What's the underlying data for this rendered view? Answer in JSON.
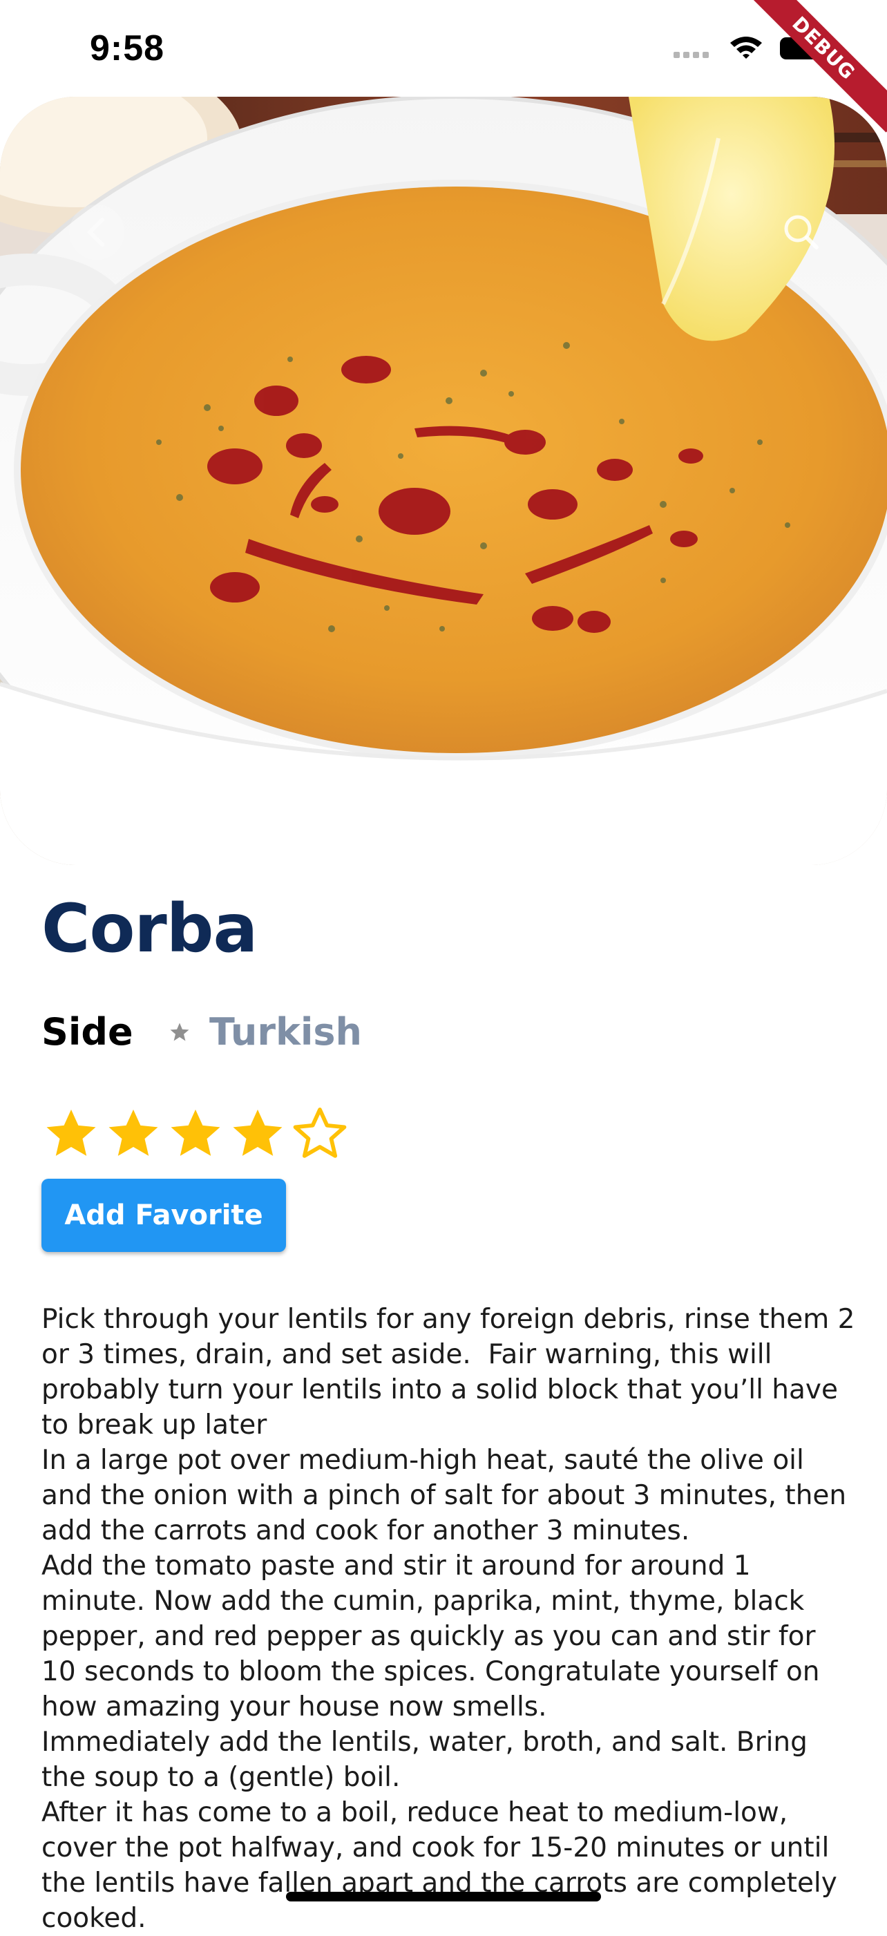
{
  "status_bar": {
    "time": "9:58",
    "icons": [
      "cellular-signal-icon",
      "wifi-icon",
      "battery-icon"
    ],
    "debug_banner": "DEBUG"
  },
  "hero": {
    "image_subject": "bowl of red lentil soup with lemon and bread",
    "icons": [
      "back-icon",
      "search-icon"
    ]
  },
  "meal": {
    "title": "Corba",
    "category": "Side",
    "area": "Turkish",
    "rating": 4,
    "rating_max": 5
  },
  "actions": {
    "favorite_label": "Add Favorite"
  },
  "instructions": "Pick through your lentils for any foreign debris, rinse them 2 or 3 times, drain, and set aside.  Fair warning, this will probably turn your lentils into a solid block that you’ll have to break up later\nIn a large pot over medium-high heat, sauté the olive oil and the onion with a pinch of salt for about 3 minutes, then add the carrots and cook for another 3 minutes.\nAdd the tomato paste and stir it around for around 1 minute. Now add the cumin, paprika, mint, thyme, black pepper, and red pepper as quickly as you can and stir for 10 seconds to bloom the spices. Congratulate yourself on how amazing your house now smells.\nImmediately add the lentils, water, broth, and salt. Bring the soup to a (gentle) boil.\nAfter it has come to a boil, reduce heat to medium-low, cover the pot halfway, and cook for 15-20 minutes or until the lentils have fallen apart and the carrots are completely cooked.",
  "colors": {
    "title": "#0f2a56",
    "area_text": "#7f8fa6",
    "star": "#ffc107",
    "button": "#2196f3",
    "debug_ribbon": "#b71c2e"
  }
}
